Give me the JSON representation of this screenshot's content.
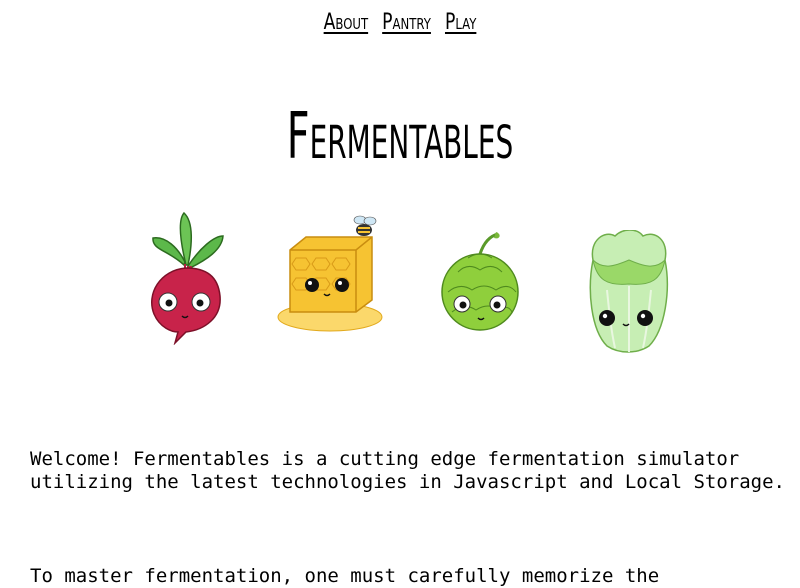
{
  "nav": {
    "items": [
      {
        "label": "About"
      },
      {
        "label": "Pantry"
      },
      {
        "label": "Play"
      }
    ]
  },
  "title": "Fermentables",
  "illustrations": [
    "beet-icon",
    "honeycomb-icon",
    "hop-icon",
    "cabbage-icon"
  ],
  "intro": {
    "p1": "Welcome! Fermentables is a cutting edge fermentation simulator utilizing the latest technologies in Javascript and Local Storage.",
    "p2": "To master fermentation, one must carefully memorize the"
  },
  "colors": {
    "beet": "#c8234a",
    "honey": "#f6c332",
    "hop": "#8fcf3c",
    "cabbage": "#c7eeb4"
  }
}
